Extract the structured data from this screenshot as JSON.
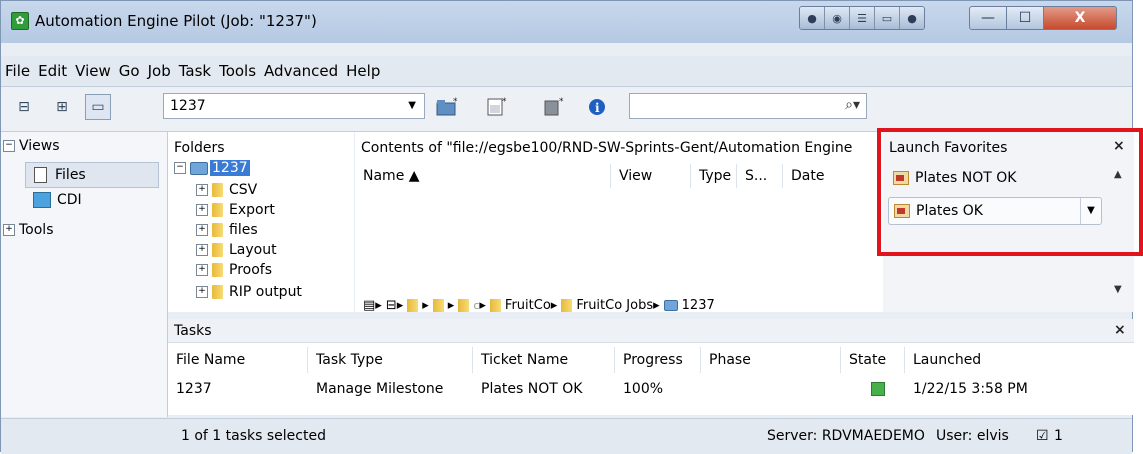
{
  "window": {
    "title": "Automation Engine Pilot (Job: \"1237\")",
    "controls": {
      "minimize": "—",
      "maximize": "☐",
      "close": "X"
    }
  },
  "menu": {
    "items": [
      "File",
      "Edit",
      "View",
      "Go",
      "Job",
      "Task",
      "Tools",
      "Advanced",
      "Help"
    ]
  },
  "toolbar": {
    "job_value": "1237",
    "search_value": "",
    "icons": [
      "layout-single-icon",
      "layout-grid-icon",
      "layout-panel-icon",
      "new-folder-icon",
      "new-file-icon",
      "new-item-icon",
      "info-icon",
      "search-icon"
    ]
  },
  "views": {
    "header": "Views",
    "items": [
      {
        "label": "Files",
        "icon": "file-icon",
        "selected": true
      },
      {
        "label": "CDI",
        "icon": "cdi-icon",
        "selected": false
      }
    ],
    "tools_label": "Tools"
  },
  "folders": {
    "header": "Folders",
    "root": "1237",
    "children": [
      "CSV",
      "Export",
      "files",
      "Layout",
      "Proofs",
      "RIP output"
    ]
  },
  "contents": {
    "header": "Contents of \"file://egsbe100/RND-SW-Sprints-Gent/Automation Engine",
    "columns": [
      "Name ▲",
      "View",
      "Type",
      "S...",
      "Date"
    ],
    "breadcrumb": [
      "c",
      "FruitCo",
      "FruitCo Jobs",
      "1237"
    ]
  },
  "launch_favorites": {
    "header": "Launch Favorites",
    "items": [
      {
        "label": "Plates NOT OK",
        "has_dropdown": false
      },
      {
        "label": "Plates OK",
        "has_dropdown": true
      }
    ],
    "close": "×"
  },
  "tasks": {
    "header": "Tasks",
    "close": "×",
    "columns": [
      "File Name",
      "Task Type",
      "Ticket Name",
      "Progress",
      "Phase",
      "State",
      "Launched"
    ],
    "rows": [
      {
        "file_name": "1237",
        "task_type": "Manage Milestone",
        "ticket_name": "Plates NOT OK",
        "progress": "100%",
        "progress_value": 1.0,
        "phase": "",
        "state": "ok",
        "launched": "1/22/15 3:58 PM"
      }
    ]
  },
  "status": {
    "selection": "1 of 1 tasks selected",
    "server": "Server: RDVMAEDEMO",
    "user": "User: elvis",
    "count": "1"
  },
  "colors": {
    "highlight_box": "#e1141d",
    "selection": "#3a7bd5",
    "state_ok": "#47b04a"
  }
}
